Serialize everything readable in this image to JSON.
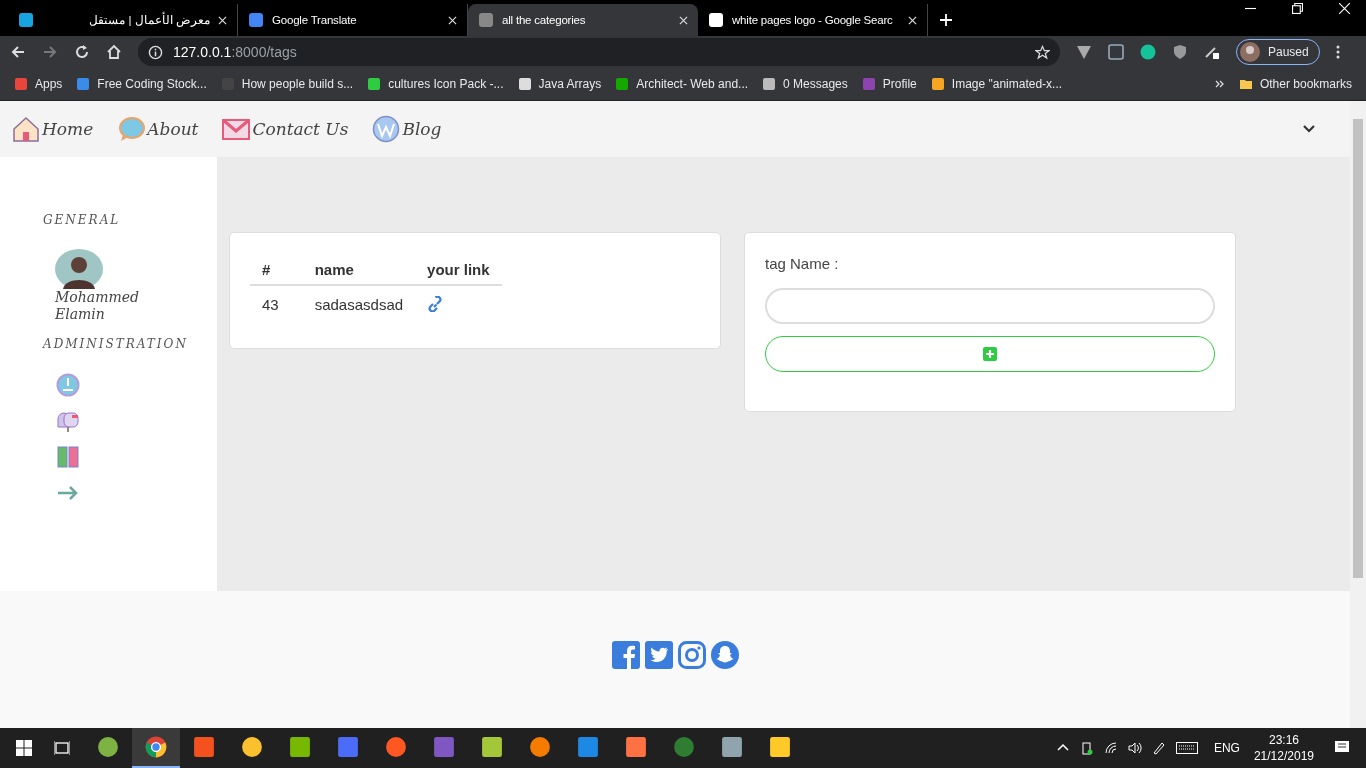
{
  "browser": {
    "tabs": [
      {
        "title": "معرض الأعمال | مستقل",
        "selected": false
      },
      {
        "title": "Google Translate",
        "selected": false
      },
      {
        "title": "all the categories",
        "selected": true
      },
      {
        "title": "white pages logo - Google Searc",
        "selected": false
      }
    ],
    "url": {
      "host": "127.0.0.1",
      "path": ":8000/tags"
    },
    "profile": {
      "label": "Paused"
    },
    "bookmarks": [
      {
        "label": "Apps",
        "color": "#e8453c"
      },
      {
        "label": "Free Coding Stock...",
        "color": "#3b8beb"
      },
      {
        "label": "How people build s...",
        "color": "#444444"
      },
      {
        "label": "cultures Icon Pack -...",
        "color": "#2ecc40"
      },
      {
        "label": "Java Arrays",
        "color": "#dddddd"
      },
      {
        "label": "Architect- Web and...",
        "color": "#14a800"
      },
      {
        "label": "0 Messages",
        "color": "#bbbbbb"
      },
      {
        "label": "Profile",
        "color": "#8e44ad"
      },
      {
        "label": "Image \"animated-x...",
        "color": "#f5a623"
      }
    ],
    "other_bookmarks": "Other bookmarks"
  },
  "nav": {
    "links": [
      {
        "label": "Home"
      },
      {
        "label": "About"
      },
      {
        "label": "Contact Us"
      },
      {
        "label": "Blog"
      }
    ]
  },
  "sidebar": {
    "general_heading": "GENERAL",
    "user_name": "Mohammed Elamin",
    "admin_heading": "ADMINISTRATION"
  },
  "table": {
    "columns": [
      "#",
      "name",
      "your link"
    ],
    "rows": [
      {
        "id": "43",
        "name": "sadasasdsad"
      }
    ]
  },
  "form": {
    "label": "tag Name :"
  },
  "taskbar": {
    "apps": [
      {
        "selected": false
      },
      {
        "selected": true
      },
      {
        "selected": false
      },
      {
        "selected": false
      },
      {
        "selected": false
      },
      {
        "selected": false
      },
      {
        "selected": false
      },
      {
        "selected": false
      },
      {
        "selected": false
      },
      {
        "selected": false
      },
      {
        "selected": false
      },
      {
        "selected": false
      },
      {
        "selected": false
      },
      {
        "selected": false
      },
      {
        "selected": false
      }
    ],
    "language": "ENG",
    "time": "23:16",
    "date": "21/12/2019"
  }
}
